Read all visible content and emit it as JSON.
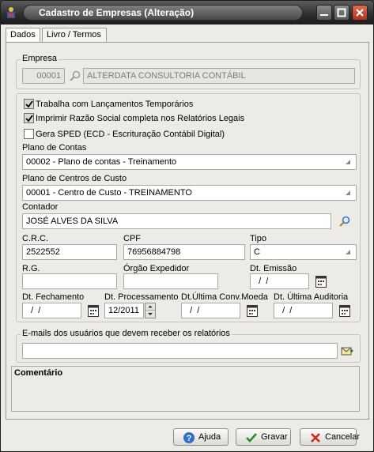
{
  "window": {
    "title": "Cadastro de Empresas (Alteração)",
    "accent_close": "#c0402a"
  },
  "tabs": [
    {
      "label": "Dados",
      "active": true
    },
    {
      "label": "Livro / Termos",
      "active": false
    }
  ],
  "empresa": {
    "group_label": "Empresa",
    "code": "00001",
    "name": "ALTERDATA CONSULTORIA CONTÁBIL"
  },
  "options": {
    "trabalha_label": "Trabalha com Lançamentos Temporários",
    "trabalha_checked": true,
    "imprimir_label": "Imprimir Razão Social completa nos Relatórios Legais",
    "imprimir_checked": true,
    "sped_label": "Gera SPED (ECD - Escrituração Contábil Digital)",
    "sped_checked": false
  },
  "plano_contas": {
    "label": "Plano de Contas",
    "value": "00002 - Plano de contas - Treinamento"
  },
  "plano_centros": {
    "label": "Plano de Centros de Custo",
    "value": "00001 - Centro de Custo - TREINAMENTO"
  },
  "contador": {
    "label": "Contador",
    "value": "JOSÉ ALVES DA SILVA"
  },
  "crc": {
    "label": "C.R.C.",
    "value": "2522552"
  },
  "cpf": {
    "label": "CPF",
    "value": "76956884798"
  },
  "tipo": {
    "label": "Tipo",
    "value": "C"
  },
  "rg": {
    "label": "R.G.",
    "value": ""
  },
  "orgao": {
    "label": "Órgão Expedidor",
    "value": ""
  },
  "dt_emissao": {
    "label": "Dt. Emissão",
    "value": "  /  /"
  },
  "dt_fechamento": {
    "label": "Dt. Fechamento",
    "value": "  /  /"
  },
  "dt_processamento": {
    "label": "Dt. Processamento",
    "value": "12/2011"
  },
  "dt_ultima_conv": {
    "label": "Dt.Última Conv.Moeda",
    "value": "  /  /"
  },
  "dt_ultima_auditoria": {
    "label": "Dt. Última Auditoria",
    "value": "  /  /"
  },
  "emails": {
    "group_label": "E-mails dos usuários que devem receber os relatórios",
    "value": ""
  },
  "comentario": {
    "label": "Comentário"
  },
  "buttons": {
    "ajuda": "Ajuda",
    "gravar": "Gravar",
    "cancelar": "Cancelar"
  }
}
